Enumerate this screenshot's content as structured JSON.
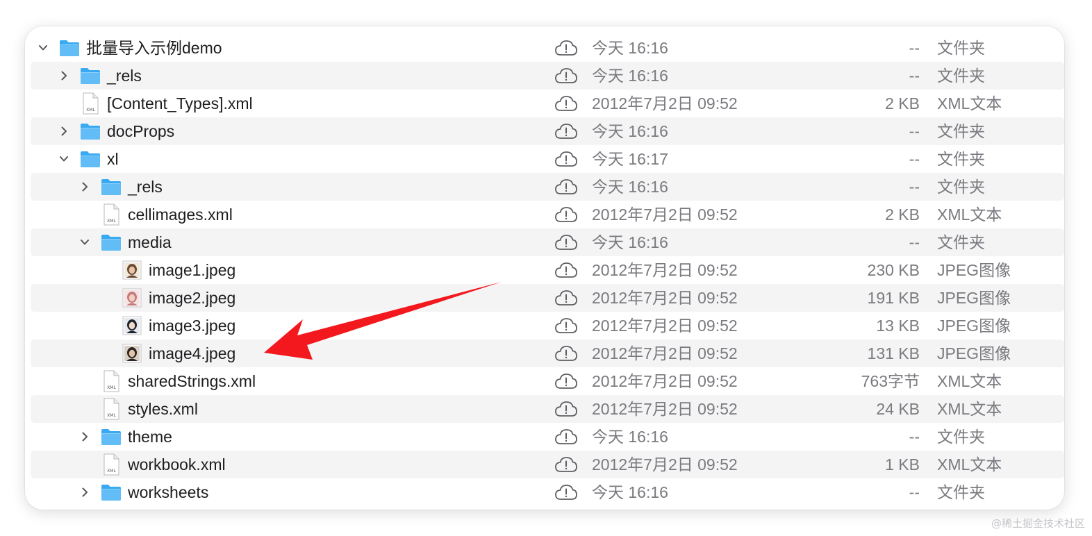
{
  "rows": [
    {
      "name": "批量导入示例demo",
      "depth": 0,
      "type": "folder",
      "expanded": true,
      "date": "今天 16:16",
      "size": "--",
      "kind": "文件夹"
    },
    {
      "name": "_rels",
      "depth": 1,
      "type": "folder",
      "expanded": false,
      "date": "今天 16:16",
      "size": "--",
      "kind": "文件夹"
    },
    {
      "name": "[Content_Types].xml",
      "depth": 1,
      "type": "xml",
      "date": "2012年7月2日 09:52",
      "size": "2 KB",
      "kind": "XML文本"
    },
    {
      "name": "docProps",
      "depth": 1,
      "type": "folder",
      "expanded": false,
      "date": "今天 16:16",
      "size": "--",
      "kind": "文件夹"
    },
    {
      "name": "xl",
      "depth": 1,
      "type": "folder",
      "expanded": true,
      "date": "今天 16:17",
      "size": "--",
      "kind": "文件夹"
    },
    {
      "name": "_rels",
      "depth": 2,
      "type": "folder",
      "expanded": false,
      "date": "今天 16:16",
      "size": "--",
      "kind": "文件夹"
    },
    {
      "name": "cellimages.xml",
      "depth": 2,
      "type": "xml",
      "date": "2012年7月2日 09:52",
      "size": "2 KB",
      "kind": "XML文本"
    },
    {
      "name": "media",
      "depth": 2,
      "type": "folder",
      "expanded": true,
      "date": "今天 16:16",
      "size": "--",
      "kind": "文件夹"
    },
    {
      "name": "image1.jpeg",
      "depth": 3,
      "type": "image",
      "date": "2012年7月2日 09:52",
      "size": "230 KB",
      "kind": "JPEG图像"
    },
    {
      "name": "image2.jpeg",
      "depth": 3,
      "type": "image",
      "date": "2012年7月2日 09:52",
      "size": "191 KB",
      "kind": "JPEG图像"
    },
    {
      "name": "image3.jpeg",
      "depth": 3,
      "type": "image",
      "date": "2012年7月2日 09:52",
      "size": "13 KB",
      "kind": "JPEG图像"
    },
    {
      "name": "image4.jpeg",
      "depth": 3,
      "type": "image",
      "date": "2012年7月2日 09:52",
      "size": "131 KB",
      "kind": "JPEG图像"
    },
    {
      "name": "sharedStrings.xml",
      "depth": 2,
      "type": "xml",
      "date": "2012年7月2日 09:52",
      "size": "763字节",
      "kind": "XML文本"
    },
    {
      "name": "styles.xml",
      "depth": 2,
      "type": "xml",
      "date": "2012年7月2日 09:52",
      "size": "24 KB",
      "kind": "XML文本"
    },
    {
      "name": "theme",
      "depth": 2,
      "type": "folder",
      "expanded": false,
      "date": "今天 16:16",
      "size": "--",
      "kind": "文件夹"
    },
    {
      "name": "workbook.xml",
      "depth": 2,
      "type": "xml",
      "date": "2012年7月2日 09:52",
      "size": "1 KB",
      "kind": "XML文本"
    },
    {
      "name": "worksheets",
      "depth": 2,
      "type": "folder",
      "expanded": false,
      "date": "今天 16:16",
      "size": "--",
      "kind": "文件夹"
    }
  ],
  "icons": {
    "folder": "folder-icon",
    "xml": "xml-file-icon",
    "image": "jpeg-thumbnail-icon",
    "cloud": "icloud-not-downloaded-icon",
    "chevron_right": "chevron-right-icon",
    "chevron_down": "chevron-down-icon"
  },
  "annotation": {
    "icon": "red-arrow-icon",
    "points_to": "image4.jpeg",
    "color": "#f2181d"
  },
  "watermark": "@稀土掘金技术社区",
  "colors": {
    "folder": "#39aaf1",
    "folder_tab": "#62bdf6",
    "text": "#1d1d1f",
    "secondary_text": "#7a7a7f",
    "stripe": "#f4f4f5",
    "arrow": "#f2181d"
  }
}
